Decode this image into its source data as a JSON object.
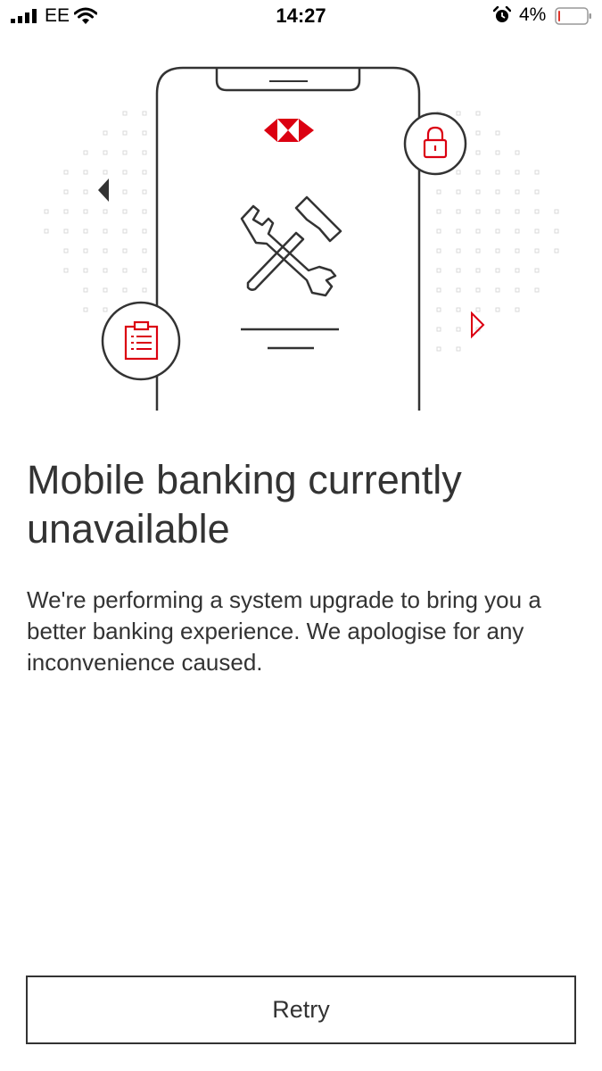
{
  "status_bar": {
    "carrier": "EE",
    "time": "14:27",
    "battery_percent": "4%",
    "battery_level": 0.04,
    "icons": [
      "signal-icon",
      "wifi-icon",
      "alarm-icon",
      "battery-icon"
    ]
  },
  "illustration": {
    "brand_logo": "hsbc-hexagon-logo",
    "icons": [
      "tools-icon",
      "padlock-icon",
      "clipboard-icon",
      "arrow-left-icon",
      "arrow-right-icon"
    ]
  },
  "main": {
    "title": "Mobile banking currently unavailable",
    "message": "We're performing a system upgrade to bring you a better banking experience. We apologise for any inconvenience caused."
  },
  "actions": {
    "retry_label": "Retry"
  },
  "colors": {
    "brand_red": "#db0011",
    "text": "#333333",
    "background": "#ffffff"
  }
}
